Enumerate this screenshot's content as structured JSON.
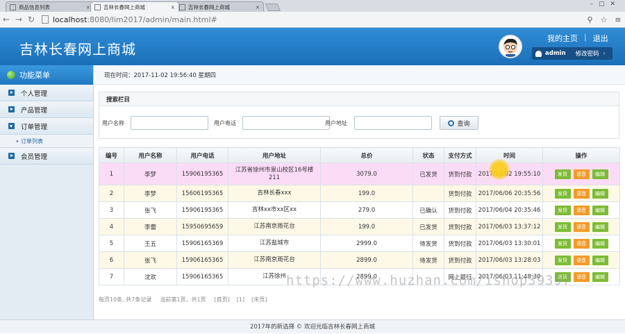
{
  "browser": {
    "tabs": [
      {
        "label": "商品信息列表",
        "active": false
      },
      {
        "label": "吉林长春网上商城",
        "active": true
      },
      {
        "label": "吉林长春网上商城",
        "active": false
      }
    ],
    "url_host": "localhost",
    "url_rest": ":8080/lim2017/admin/main.html#"
  },
  "header": {
    "title": "吉林长春网上商城",
    "link_home": "我的主页",
    "link_logout": "退出",
    "username": "admin",
    "change_password": "修改密码"
  },
  "sidebar": {
    "title": "功能菜单",
    "items": [
      {
        "label": "个人管理",
        "open": false
      },
      {
        "label": "产品管理",
        "open": false
      },
      {
        "label": "订单管理",
        "open": true
      },
      {
        "label": "会员管理",
        "open": false
      }
    ],
    "submenu_label": "订单列表"
  },
  "main": {
    "time_text": "现在时间：2017-11-02 19:56:40 星期四",
    "search": {
      "title": "搜索栏目",
      "name_label": "用户名称",
      "phone_label": "用户电话",
      "address_label": "用户地址",
      "button": "查询"
    },
    "table": {
      "headers": [
        "编号",
        "用户名称",
        "用户电话",
        "用户地址",
        "总价",
        "状态",
        "支付方式",
        "时间",
        "操作"
      ],
      "rows": [
        {
          "id": "1",
          "name": "李梦",
          "phone": "15906195365",
          "address": "江苏省徐州市泉山校区16号楼211",
          "total": "3079.0",
          "status": "已发货",
          "pay": "货到付款",
          "time": "2017/11/02 19:55:10"
        },
        {
          "id": "2",
          "name": "李梦",
          "phone": "15606195365",
          "address": "吉林长春xxx",
          "total": "199.0",
          "status": "",
          "pay": "货到付款",
          "time": "2017/06/06 20:35:56"
        },
        {
          "id": "3",
          "name": "张飞",
          "phone": "15906195365",
          "address": "吉林xx市xx区xx",
          "total": "279.0",
          "status": "已确认",
          "pay": "货到付款",
          "time": "2017/06/04 20:35:46"
        },
        {
          "id": "4",
          "name": "李蕾",
          "phone": "15950695659",
          "address": "江苏南京雨花台",
          "total": "199.0",
          "status": "已发货",
          "pay": "货到付款",
          "time": "2017/06/03 13:37:12"
        },
        {
          "id": "5",
          "name": "王五",
          "phone": "15906165369",
          "address": "江苏盐城市",
          "total": "2999.0",
          "status": "待发货",
          "pay": "货到付款",
          "time": "2017/06/03 13:30:01"
        },
        {
          "id": "6",
          "name": "张飞",
          "phone": "15906165365",
          "address": "江苏南京雨花台",
          "total": "2899.0",
          "status": "待发货",
          "pay": "货到付款",
          "time": "2017/06/03 13:28:03"
        },
        {
          "id": "7",
          "name": "沈欢",
          "phone": "15906165365",
          "address": "江苏徐州",
          "total": "2899.0",
          "status": "",
          "pay": "网上银行",
          "time": "2017/06/03 11:48:30"
        }
      ],
      "actions": [
        "发货",
        "语音",
        "编辑"
      ]
    },
    "pager": {
      "summary": "每页10条, 共7条记录",
      "page_info": "当前第1页，共1页",
      "prev": "[首页]",
      "current": "[1]",
      "last": "[末页]"
    }
  },
  "footer": {
    "text": "2017年的新选择 © 欢迎光临吉林长春网上商城"
  },
  "watermark": {
    "text": "https://www.huzhan.com/ishop39397"
  },
  "colors": {
    "header_blue": "#1b6fb8",
    "highlight_row": "#fbdcf6",
    "alt_row": "#fdf9e6",
    "action_green": "#7cbc34",
    "action_orange": "#f29b28"
  }
}
